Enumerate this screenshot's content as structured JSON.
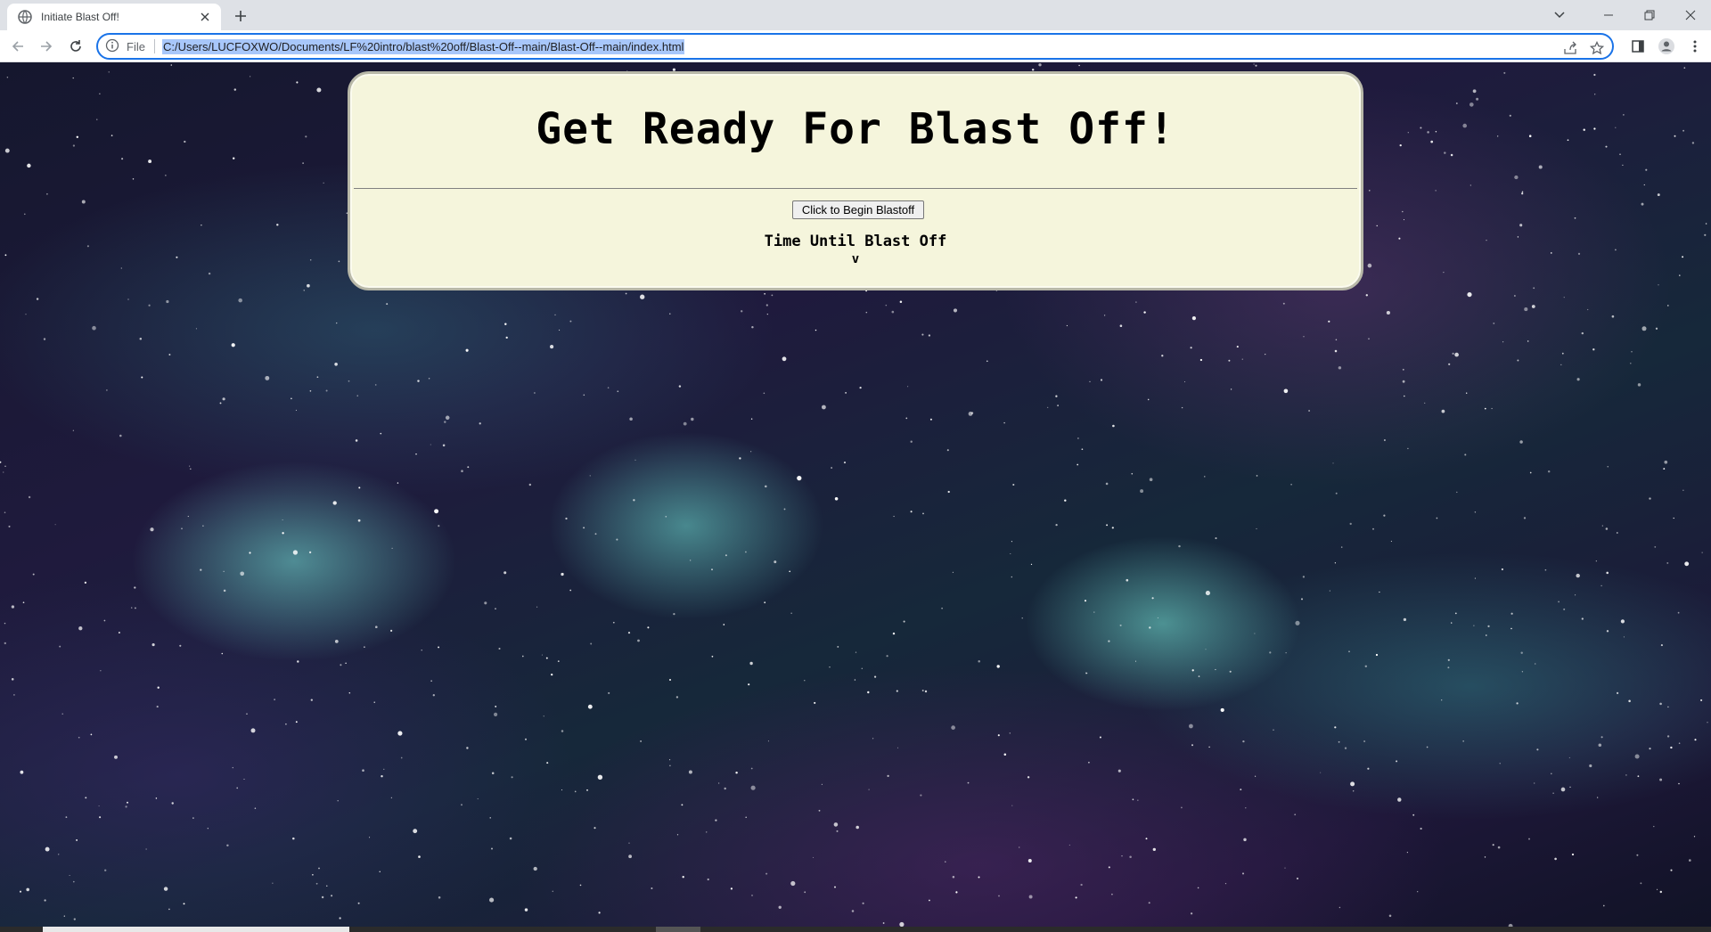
{
  "browser": {
    "tab_title": "Initiate Blast Off!",
    "omnibox": {
      "scheme_label": "File",
      "url": "C:/Users/LUCFOXWO/Documents/LF%20intro/blast%20off/Blast-Off--main/Blast-Off--main/index.html"
    },
    "icons": {
      "favicon": "globe-icon",
      "close": "close-icon",
      "new_tab": "plus-icon",
      "tab_search": "chevron-down-icon",
      "minimize": "minimize-icon",
      "maximize": "restore-icon",
      "window_close": "close-icon",
      "back": "arrow-left-icon",
      "forward": "arrow-right-icon",
      "reload": "reload-icon",
      "info": "info-icon",
      "share": "share-icon",
      "bookmark": "star-icon",
      "side_panel": "side-panel-icon",
      "profile": "profile-icon",
      "menu": "kebab-menu-icon"
    }
  },
  "page": {
    "heading": "Get Ready For Blast Off!",
    "start_button_label": "Click to Begin Blastoff",
    "countdown_label": "Time Until Blast Off",
    "countdown_value": "v",
    "colors": {
      "panel_bg": "#f5f5dc",
      "omnibox_border": "#1a73e8",
      "url_highlight": "#a8c7fa"
    }
  }
}
